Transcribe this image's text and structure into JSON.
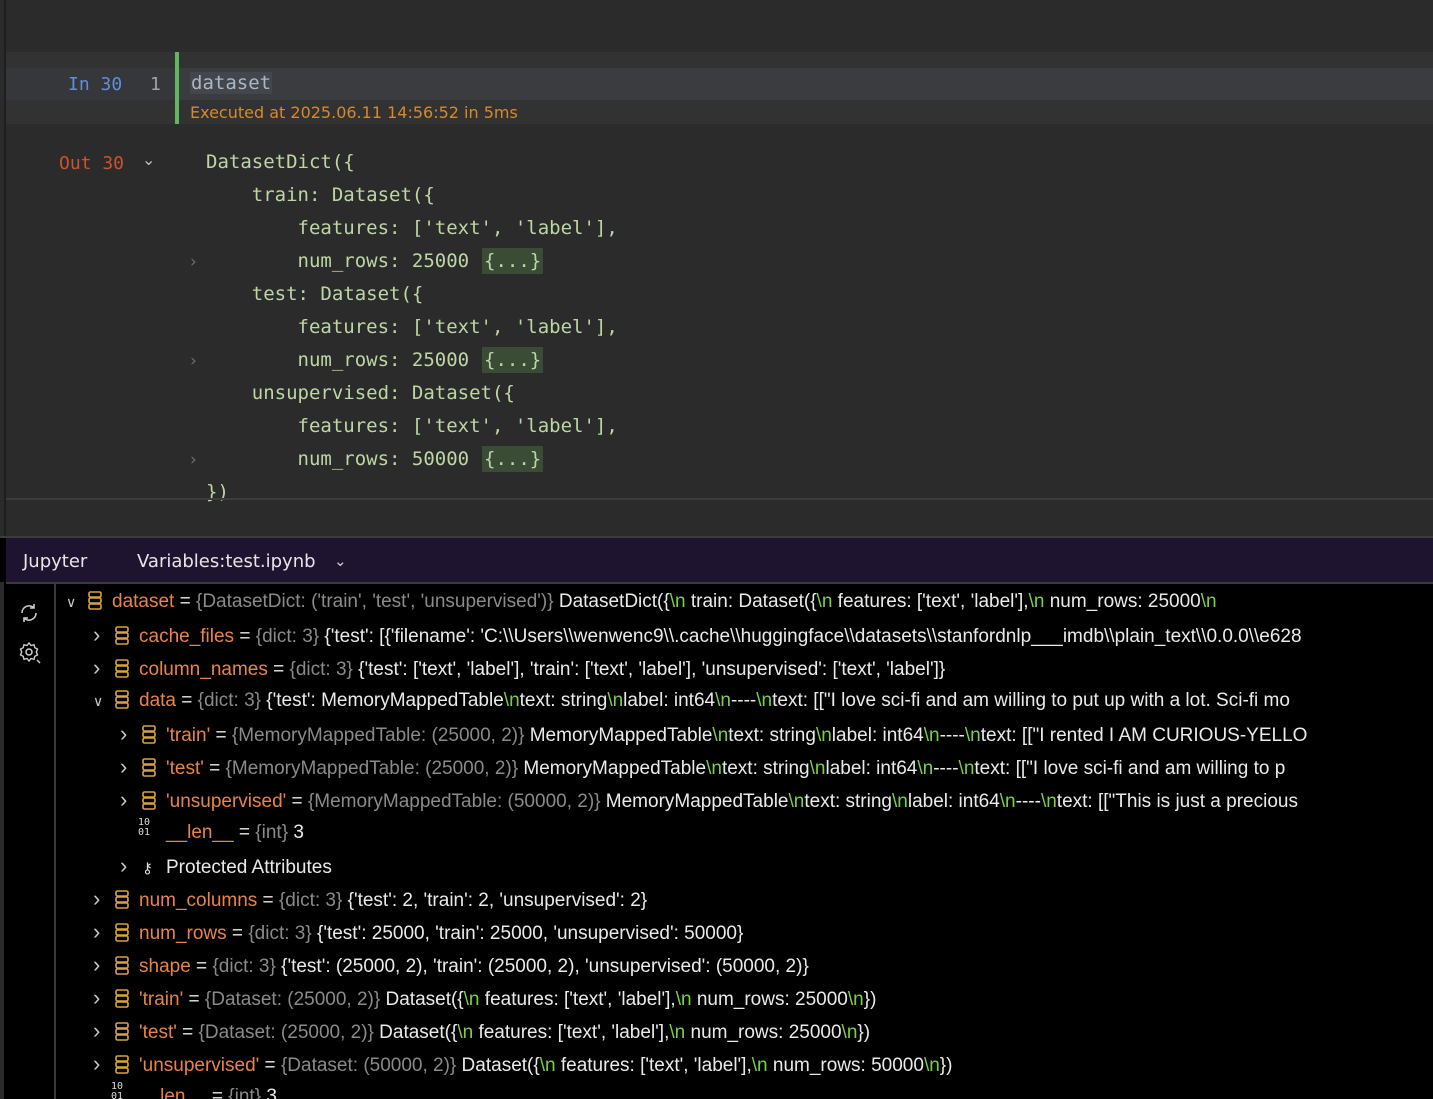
{
  "notebook": {
    "in_label": "In 30",
    "line_number": "1",
    "code": "dataset",
    "executed": "Executed at 2025.06.11 14:56:52 in 5ms",
    "out_label": "Out 30",
    "output_lines": [
      "DatasetDict({",
      "    train: Dataset({",
      "        features: ['text', 'label'],",
      "        num_rows: 25000",
      "    test: Dataset({",
      "        features: ['text', 'label'],",
      "        num_rows: 25000",
      "    unsupervised: Dataset({",
      "        features: ['text', 'label'],",
      "        num_rows: 50000",
      "})"
    ],
    "fold_marker": "{...}"
  },
  "panel": {
    "tab_jupyter": "Jupyter",
    "tab_variables": "Variables:test.ipynb"
  },
  "tree": [
    {
      "name": "dataset",
      "type": "{DatasetDict: ('train', 'test', 'unsupervised')}",
      "value": [
        " DatasetDict({",
        "\\n",
        "    train: Dataset({",
        "\\n",
        "        features: ['text', 'label'],",
        "\\n",
        "        num_rows: 25000",
        "\\n"
      ]
    },
    {
      "name": "cache_files",
      "type": "{dict: 3}",
      "value": [
        " {'test': [{'filename': 'C:\\\\Users\\\\wenwenc9\\\\.cache\\\\huggingface\\\\datasets\\\\stanfordnlp___imdb\\\\plain_text\\\\0.0.0\\\\e628"
      ]
    },
    {
      "name": "column_names",
      "type": "{dict: 3}",
      "value": [
        " {'test': ['text', 'label'], 'train': ['text', 'label'], 'unsupervised': ['text', 'label']}"
      ]
    },
    {
      "name": "data",
      "type": "{dict: 3}",
      "value": [
        " {'test': MemoryMappedTable",
        "\\n",
        "text: string",
        "\\n",
        "label: int64",
        "\\n",
        "----",
        "\\n",
        "text: [[\"I love sci-fi and am willing to put up with a lot. Sci-fi mo"
      ]
    },
    {
      "name": "'train'",
      "type": "{MemoryMappedTable: (25000, 2)}",
      "value": [
        " MemoryMappedTable",
        "\\n",
        "text: string",
        "\\n",
        "label: int64",
        "\\n",
        "----",
        "\\n",
        "text: [[\"I rented I AM CURIOUS-YELLO"
      ]
    },
    {
      "name": "'test'",
      "type": "{MemoryMappedTable: (25000, 2)}",
      "value": [
        " MemoryMappedTable",
        "\\n",
        "text: string",
        "\\n",
        "label: int64",
        "\\n",
        "----",
        "\\n",
        "text: [[\"I love sci-fi and am willing to p"
      ]
    },
    {
      "name": "'unsupervised'",
      "type": "{MemoryMappedTable: (50000, 2)}",
      "value": [
        " MemoryMappedTable",
        "\\n",
        "text: string",
        "\\n",
        "label: int64",
        "\\n",
        "----",
        "\\n",
        "text: [[\"This is just a precious"
      ]
    },
    {
      "name": "__len__",
      "type": "{int}",
      "value": [
        " 3"
      ]
    },
    {
      "label": "Protected Attributes"
    },
    {
      "name": "num_columns",
      "type": "{dict: 3}",
      "value": [
        " {'test': 2, 'train': 2, 'unsupervised': 2}"
      ]
    },
    {
      "name": "num_rows",
      "type": "{dict: 3}",
      "value": [
        " {'test': 25000, 'train': 25000, 'unsupervised': 50000}"
      ]
    },
    {
      "name": "shape",
      "type": "{dict: 3}",
      "value": [
        " {'test': (25000, 2), 'train': (25000, 2), 'unsupervised': (50000, 2)}"
      ]
    },
    {
      "name": "'train'",
      "type": "{Dataset: (25000, 2)}",
      "value": [
        " Dataset({",
        "\\n",
        "    features: ['text', 'label'],",
        "\\n",
        "    num_rows: 25000",
        "\\n",
        "})"
      ]
    },
    {
      "name": "'test'",
      "type": "{Dataset: (25000, 2)}",
      "value": [
        " Dataset({",
        "\\n",
        "    features: ['text', 'label'],",
        "\\n",
        "    num_rows: 25000",
        "\\n",
        "})"
      ]
    },
    {
      "name": "'unsupervised'",
      "type": "{Dataset: (50000, 2)}",
      "value": [
        " Dataset({",
        "\\n",
        "    features: ['text', 'label'],",
        "\\n",
        "    num_rows: 50000",
        "\\n",
        "})"
      ]
    },
    {
      "name": "__len__",
      "type": "{int}",
      "value": [
        " 3"
      ]
    }
  ],
  "icons": {
    "expanded": "chevron-down-icon",
    "collapsed": "chevron-right-icon",
    "variable": "database-icon",
    "int": "binary-icon",
    "protected": "key-icon",
    "refresh": "refresh-icon",
    "settings": "settings-icon"
  }
}
